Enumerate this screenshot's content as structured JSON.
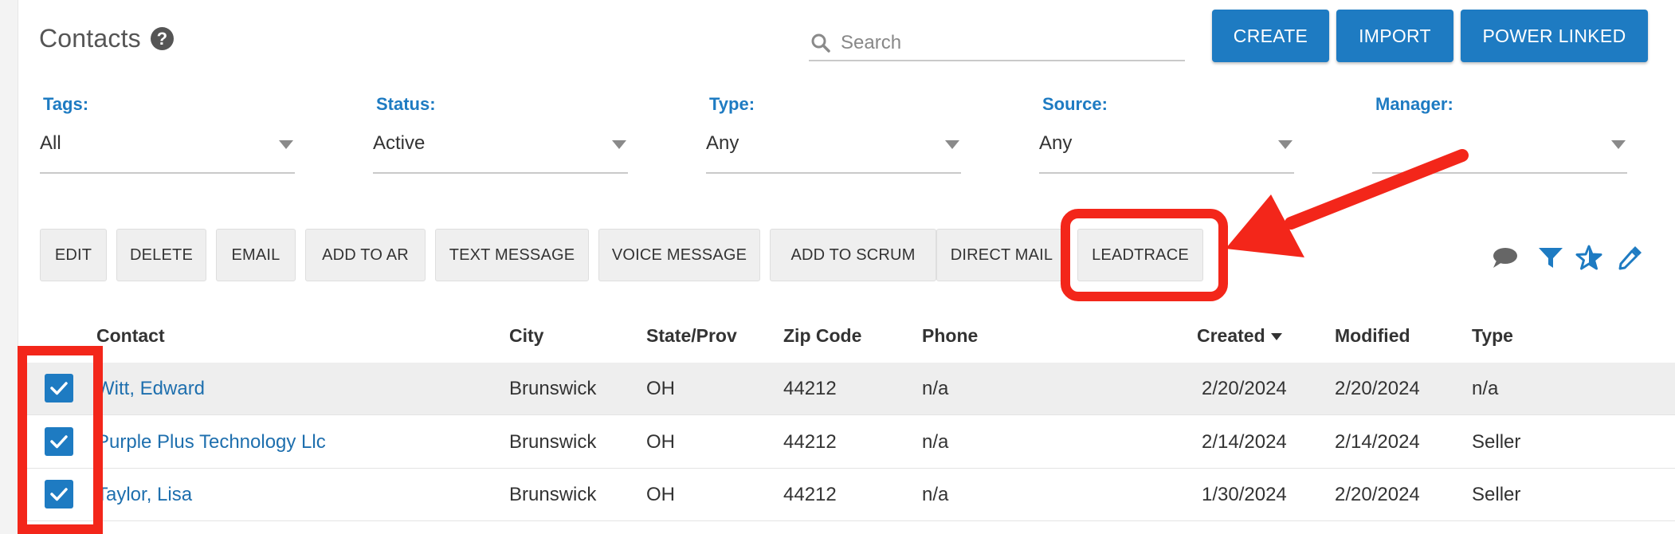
{
  "header": {
    "title": "Contacts",
    "help_symbol": "?",
    "search_placeholder": "Search",
    "buttons": {
      "create": "CREATE",
      "import": "IMPORT",
      "power_linked": "POWER LINKED"
    }
  },
  "filters": [
    {
      "label": "Tags:",
      "value": "All"
    },
    {
      "label": "Status:",
      "value": "Active"
    },
    {
      "label": "Type:",
      "value": "Any"
    },
    {
      "label": "Source:",
      "value": "Any"
    },
    {
      "label": "Manager:",
      "value": ""
    }
  ],
  "actions": [
    "EDIT",
    "DELETE",
    "EMAIL",
    "ADD TO AR",
    "TEXT MESSAGE",
    "VOICE MESSAGE",
    "ADD TO SCRUM",
    "DIRECT MAIL",
    "LEADTRACE"
  ],
  "toolbar_icons": [
    "chat-bubble-icon",
    "filter-icon",
    "star-icon",
    "eyedropper-icon"
  ],
  "table": {
    "columns": [
      "Contact",
      "City",
      "State/Prov",
      "Zip Code",
      "Phone",
      "Created",
      "Modified",
      "Type"
    ],
    "sorted_column": "Created",
    "rows": [
      {
        "contact": "Witt, Edward",
        "city": "Brunswick",
        "state": "OH",
        "zip": "44212",
        "phone": "n/a",
        "created": "2/20/2024",
        "modified": "2/20/2024",
        "type": "n/a",
        "checked": true
      },
      {
        "contact": "Purple Plus Technology Llc",
        "city": "Brunswick",
        "state": "OH",
        "zip": "44212",
        "phone": "n/a",
        "created": "2/14/2024",
        "modified": "2/14/2024",
        "type": "Seller",
        "checked": true
      },
      {
        "contact": "Taylor, Lisa",
        "city": "Brunswick",
        "state": "OH",
        "zip": "44212",
        "phone": "n/a",
        "created": "1/30/2024",
        "modified": "2/20/2024",
        "type": "Seller",
        "checked": true
      }
    ]
  },
  "colors": {
    "accent": "#1e7bc2",
    "annotation": "#f3261a",
    "link": "#1e6fae"
  }
}
